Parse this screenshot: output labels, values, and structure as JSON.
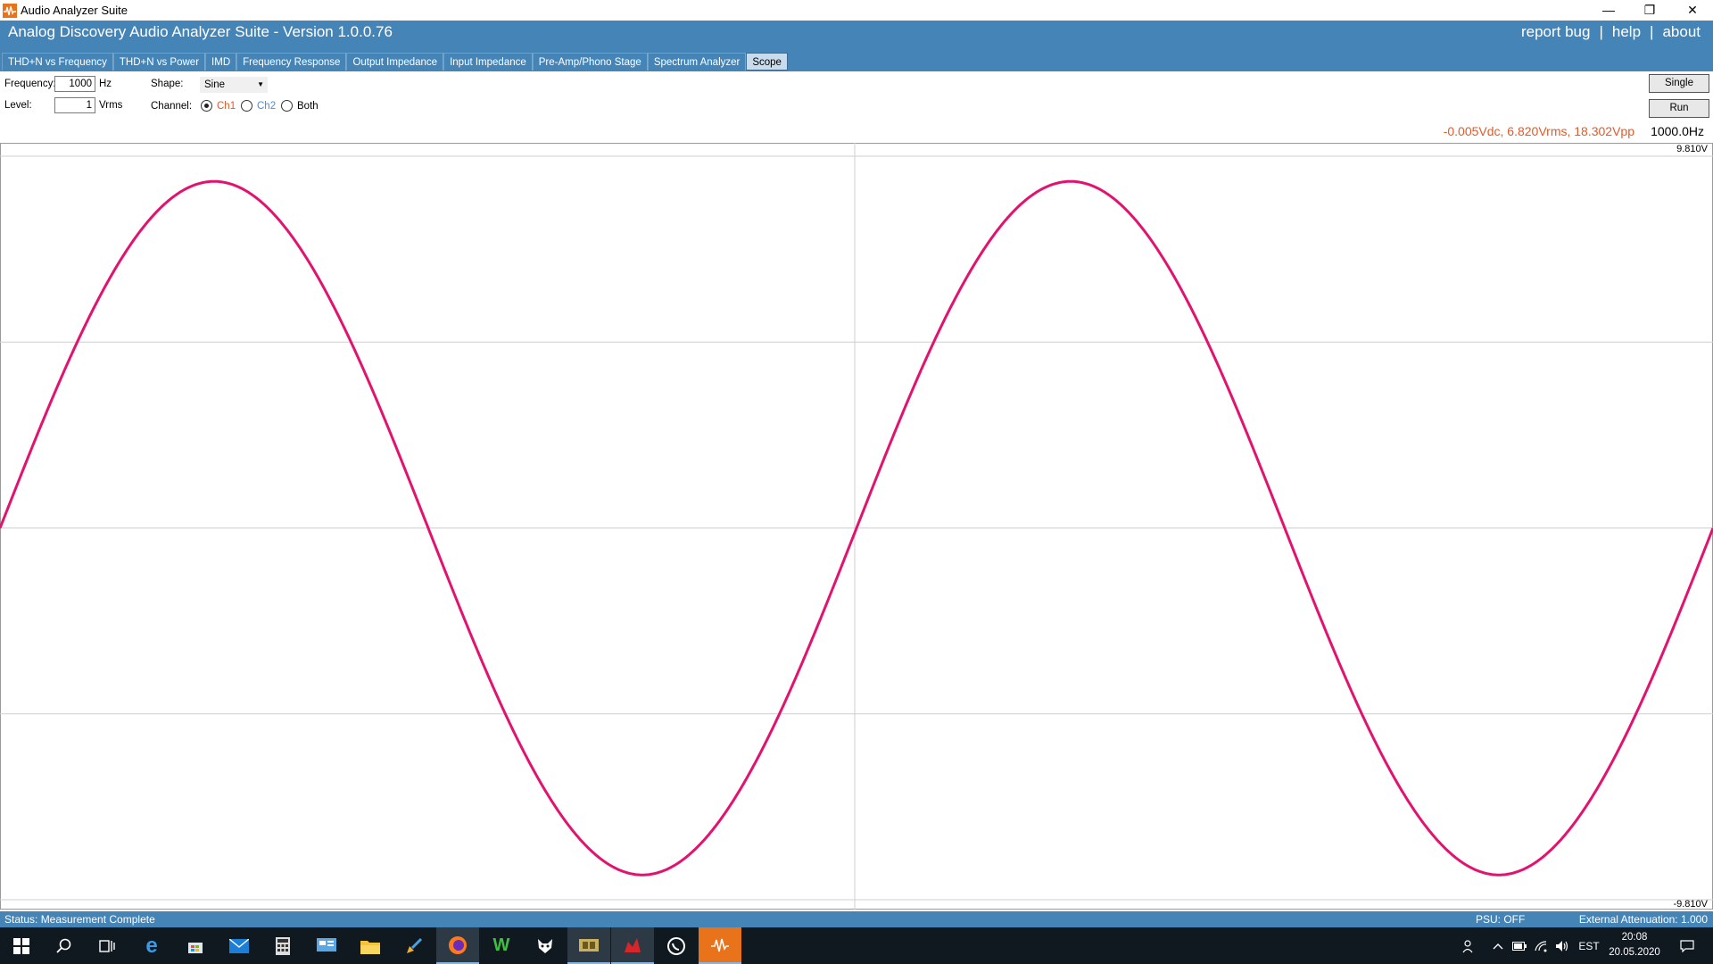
{
  "window": {
    "title": "Audio Analyzer Suite",
    "controls": {
      "minimize": "—",
      "restore": "❐",
      "close": "✕"
    }
  },
  "header": {
    "app_title": "Analog Discovery Audio Analyzer Suite - Version   1.0.0.76",
    "links": [
      "report bug",
      "|",
      "help",
      "|",
      "about"
    ]
  },
  "tabs": [
    {
      "label": "THD+N vs Frequency",
      "active": false
    },
    {
      "label": "THD+N vs Power",
      "active": false
    },
    {
      "label": "IMD",
      "active": false
    },
    {
      "label": "Frequency Response",
      "active": false
    },
    {
      "label": "Output Impedance",
      "active": false
    },
    {
      "label": "Input Impedance",
      "active": false
    },
    {
      "label": "Pre-Amp/Phono Stage",
      "active": false
    },
    {
      "label": "Spectrum Analyzer",
      "active": false
    },
    {
      "label": "Scope",
      "active": true
    }
  ],
  "controls": {
    "frequency_label": "Frequency:",
    "frequency_value": "1000",
    "frequency_unit": "Hz",
    "level_label": "Level:",
    "level_value": "1",
    "level_unit": "Vrms",
    "shape_label": "Shape:",
    "shape_value": "Sine",
    "channel_label": "Channel:",
    "channel_options": [
      {
        "label": "Ch1",
        "selected": true,
        "color": "#e25a29"
      },
      {
        "label": "Ch2",
        "selected": false,
        "color": "#4a90d9"
      },
      {
        "label": "Both",
        "selected": false,
        "color": "#000000"
      }
    ],
    "single_button": "Single",
    "run_button": "Run"
  },
  "readout": {
    "measurement": "-0.005Vdc, 6.820Vrms, 18.302Vpp",
    "measurement_color": "#e25a29",
    "frequency": "1000.0Hz"
  },
  "chart_data": {
    "type": "line",
    "series": [
      {
        "color": "#e3126e",
        "waveform": "sine",
        "cycles_shown": 2.0,
        "amplitude_v": 9.15,
        "offset_v": -0.005,
        "start_phase_deg": 0
      }
    ],
    "ylim": [
      -9.81,
      9.81
    ],
    "y_max_label": "9.810V",
    "y_min_label": "-9.810V",
    "grid": true
  },
  "status": {
    "text": "Status: Measurement Complete",
    "psu": "PSU: OFF",
    "attenuation": "External Attenuation: 1.000"
  },
  "taskbar": {
    "icons": [
      "windows-start-icon",
      "search-icon",
      "task-view-icon",
      "edge-icon",
      "store-icon",
      "mail-icon",
      "calculator-icon",
      "control-panel-icon",
      "file-explorer-icon",
      "brush-icon",
      "firefox-icon",
      "w-app-icon",
      "fox-app-icon",
      "gpu-app-icon",
      "red-app-icon",
      "whatsapp-icon",
      "audio-analyzer-icon"
    ],
    "tray": {
      "lang": "EST",
      "time": "20:08",
      "date": "20.05.2020"
    }
  }
}
